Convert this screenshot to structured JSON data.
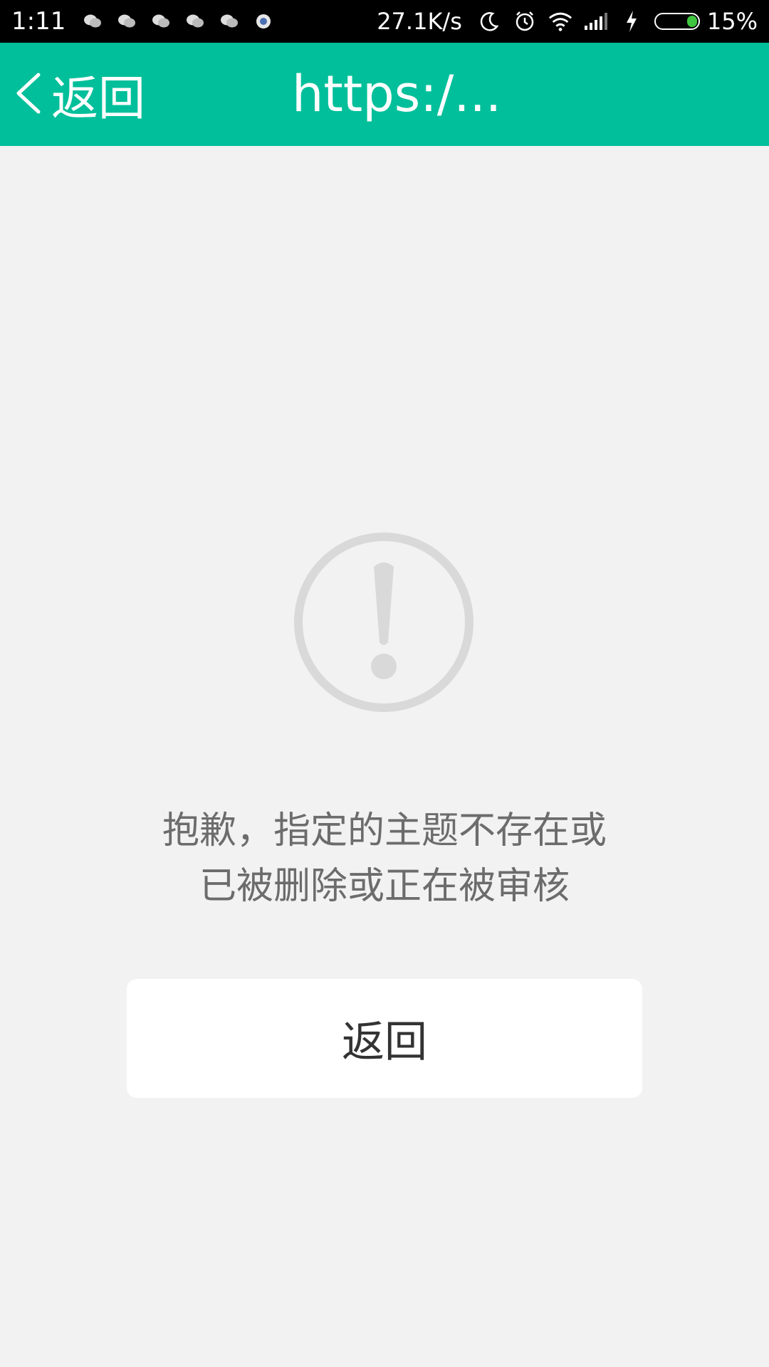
{
  "status_bar": {
    "time": "1:11",
    "notification_icons": [
      "wechat-icon",
      "wechat-icon",
      "wechat-icon",
      "wechat-icon",
      "wechat-icon",
      "browser-icon"
    ],
    "network_speed": "27.1K/s",
    "system_icons": [
      "moon-icon",
      "alarm-icon",
      "wifi-icon",
      "signal-icon",
      "charging-icon"
    ],
    "battery_percent": "15%",
    "battery_color": "#3fc53f"
  },
  "app_bar": {
    "back_label": "返回",
    "title": "https:/...",
    "accent_color": "#00bf9a"
  },
  "content": {
    "icon": "exclamation-circle-icon",
    "message_line1": "抱歉，指定的主题不存在或",
    "message_line2": "已被删除或正在被审核",
    "return_button_label": "返回"
  }
}
